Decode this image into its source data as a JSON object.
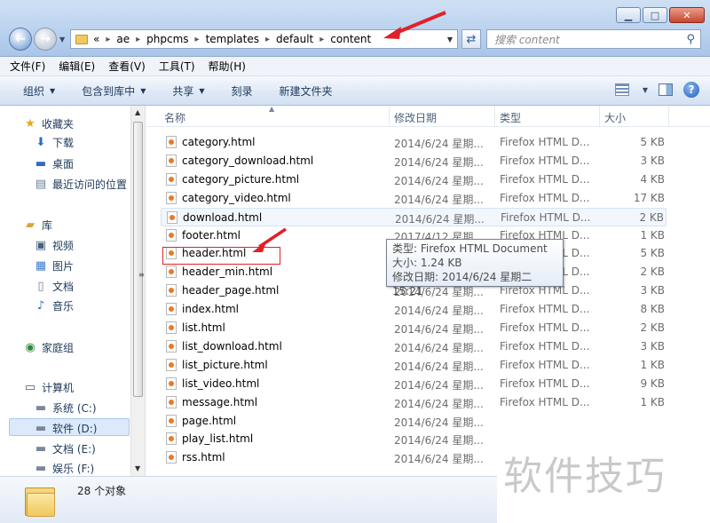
{
  "window": {
    "minimize_icon": "minimize-icon",
    "maximize_icon": "maximize-icon",
    "close_icon": "close-icon"
  },
  "address": {
    "prefix": "«",
    "crumbs": [
      "ae",
      "phpcms",
      "templates",
      "default",
      "content"
    ]
  },
  "search": {
    "placeholder": "搜索 content"
  },
  "menu": [
    "文件(F)",
    "编辑(E)",
    "查看(V)",
    "工具(T)",
    "帮助(H)"
  ],
  "commands": [
    {
      "label": "组织",
      "dropdown": true
    },
    {
      "label": "包含到库中",
      "dropdown": true
    },
    {
      "label": "共享",
      "dropdown": true
    },
    {
      "label": "刻录",
      "dropdown": false
    },
    {
      "label": "新建文件夹",
      "dropdown": false
    }
  ],
  "nav": {
    "favorites": {
      "label": "收藏夹",
      "items": [
        "下载",
        "桌面",
        "最近访问的位置"
      ]
    },
    "libraries": {
      "label": "库",
      "items": [
        "视频",
        "图片",
        "文档",
        "音乐"
      ]
    },
    "homegroup": "家庭组",
    "computer": {
      "label": "计算机",
      "items": [
        "系统 (C:)",
        "软件 (D:)",
        "文档 (E:)",
        "娱乐 (F:)"
      ],
      "selected": "软件 (D:)"
    }
  },
  "columns": {
    "name": "名称",
    "date": "修改日期",
    "type": "类型",
    "size": "大小"
  },
  "files": [
    {
      "name": "category.html",
      "date": "2014/6/24 星期...",
      "type": "Firefox HTML D...",
      "size": "5 KB"
    },
    {
      "name": "category_download.html",
      "date": "2014/6/24 星期...",
      "type": "Firefox HTML D...",
      "size": "3 KB"
    },
    {
      "name": "category_picture.html",
      "date": "2014/6/24 星期...",
      "type": "Firefox HTML D...",
      "size": "4 KB"
    },
    {
      "name": "category_video.html",
      "date": "2014/6/24 星期...",
      "type": "Firefox HTML D...",
      "size": "17 KB"
    },
    {
      "name": "download.html",
      "date": "2014/6/24 星期...",
      "type": "Firefox HTML D...",
      "size": "2 KB"
    },
    {
      "name": "footer.html",
      "date": "2017/4/12 星期...",
      "type": "Firefox HTML D...",
      "size": "1 KB"
    },
    {
      "name": "header.html",
      "date": "",
      "type": "Firefox HTML D...",
      "size": "5 KB"
    },
    {
      "name": "header_min.html",
      "date": "",
      "type": "Firefox HTML D...",
      "size": "2 KB"
    },
    {
      "name": "header_page.html",
      "date": "2014/6/24 星期...",
      "type": "Firefox HTML D...",
      "size": "3 KB"
    },
    {
      "name": "index.html",
      "date": "2014/6/24 星期...",
      "type": "Firefox HTML D...",
      "size": "8 KB"
    },
    {
      "name": "list.html",
      "date": "2014/6/24 星期...",
      "type": "Firefox HTML D...",
      "size": "2 KB"
    },
    {
      "name": "list_download.html",
      "date": "2014/6/24 星期...",
      "type": "Firefox HTML D...",
      "size": "3 KB"
    },
    {
      "name": "list_picture.html",
      "date": "2014/6/24 星期...",
      "type": "Firefox HTML D...",
      "size": "1 KB"
    },
    {
      "name": "list_video.html",
      "date": "2014/6/24 星期...",
      "type": "Firefox HTML D...",
      "size": "9 KB"
    },
    {
      "name": "message.html",
      "date": "2014/6/24 星期...",
      "type": "Firefox HTML D...",
      "size": "1 KB"
    },
    {
      "name": "page.html",
      "date": "2014/6/24 星期...",
      "type": "",
      "size": ""
    },
    {
      "name": "play_list.html",
      "date": "2014/6/24 星期...",
      "type": "",
      "size": ""
    },
    {
      "name": "rss.html",
      "date": "2014/6/24 星期...",
      "type": "",
      "size": ""
    }
  ],
  "tooltip": {
    "type": "类型: Firefox HTML Document",
    "size": "大小: 1.24 KB",
    "date": "修改日期: 2014/6/24 星期二 15:21"
  },
  "status": {
    "count": "28 个对象"
  },
  "watermark": "软件技巧",
  "colors": {
    "annotation_red": "#e0212a"
  }
}
